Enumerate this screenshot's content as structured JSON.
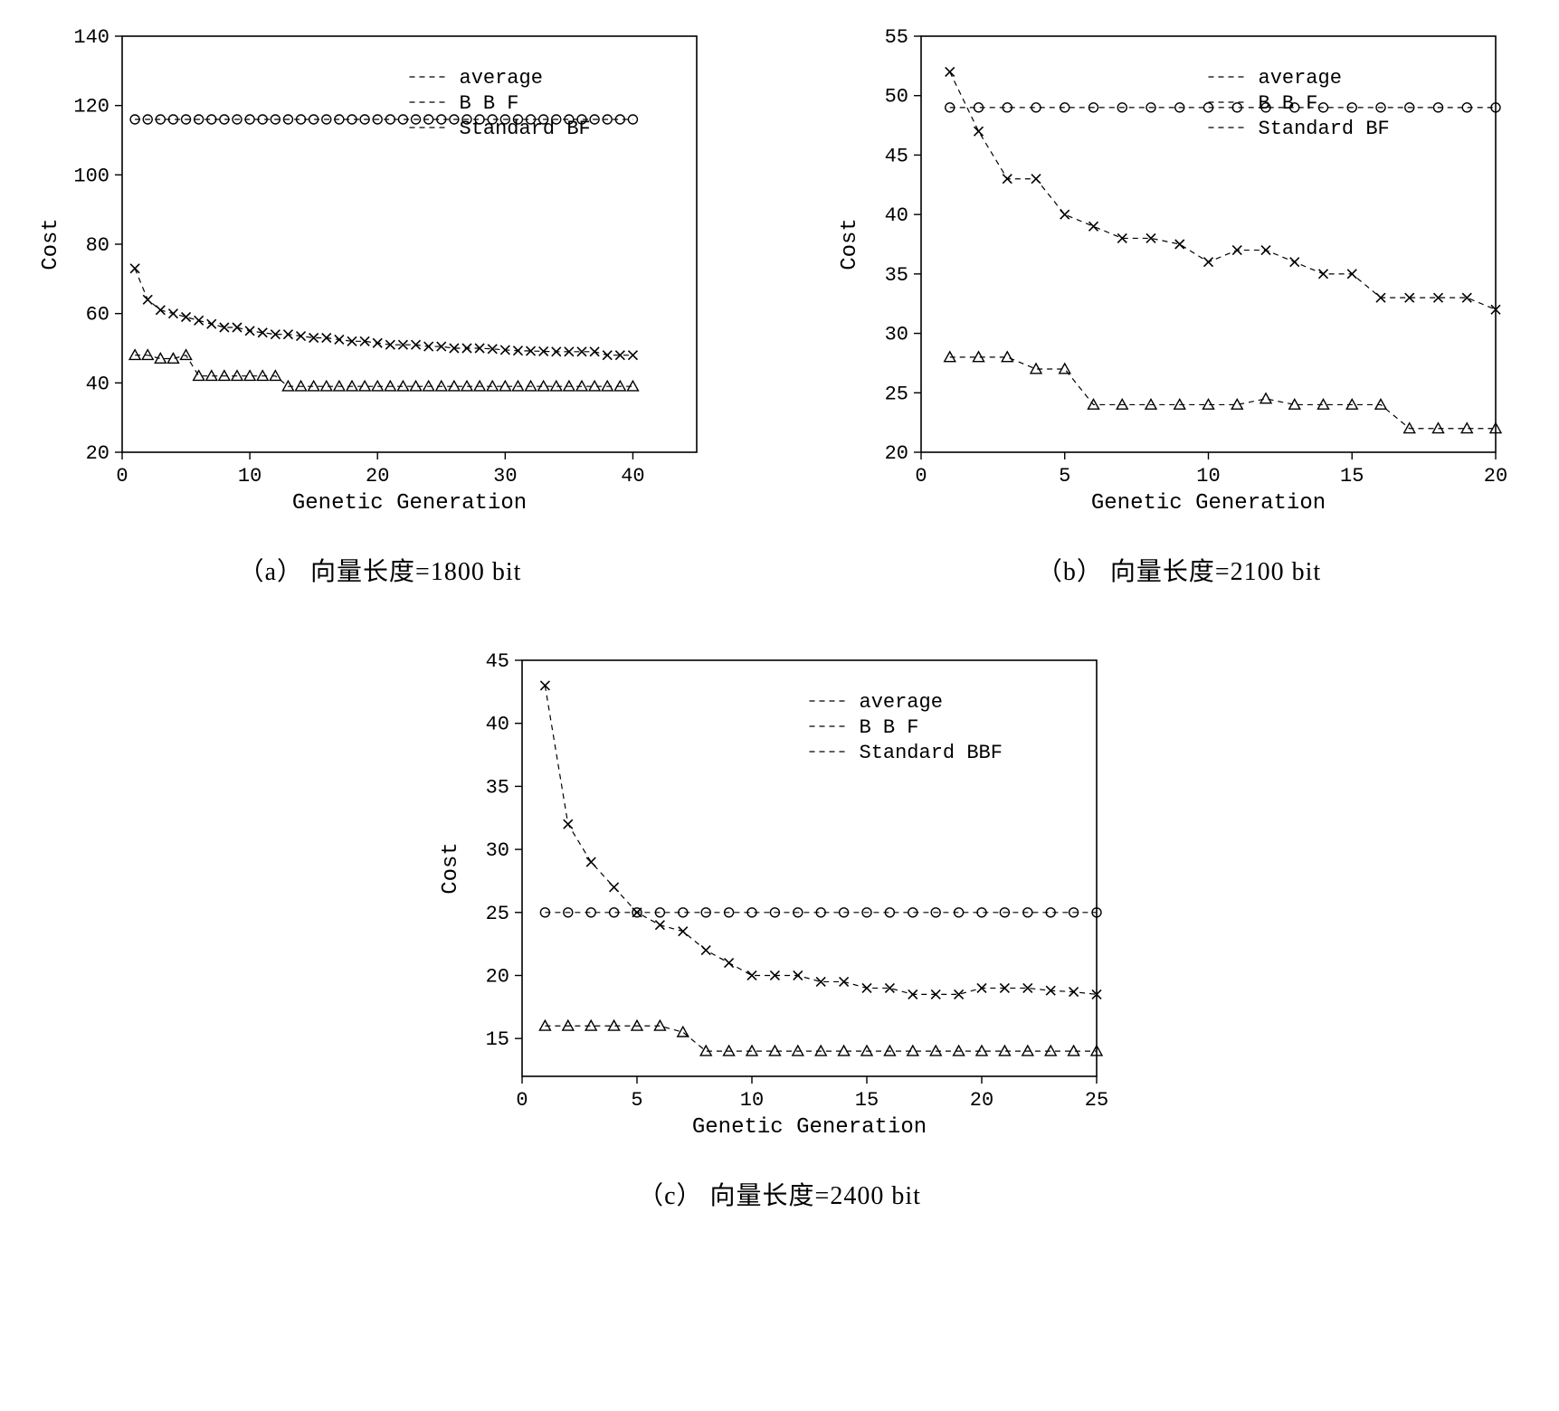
{
  "chart_data": [
    {
      "id": "a",
      "type": "line",
      "caption": "（a） 向量长度=1800 bit",
      "xlabel": "Genetic Generation",
      "ylabel": "Cost",
      "xlim": [
        0,
        45
      ],
      "ylim": [
        20,
        140
      ],
      "xticks": [
        0,
        10,
        20,
        30,
        40
      ],
      "yticks": [
        20,
        40,
        60,
        80,
        100,
        120,
        140
      ],
      "legend": [
        "average",
        "B B F",
        "Standard BF"
      ],
      "series": [
        {
          "name": "average",
          "marker": "x",
          "x": [
            1,
            2,
            3,
            4,
            5,
            6,
            7,
            8,
            9,
            10,
            11,
            12,
            13,
            14,
            15,
            16,
            17,
            18,
            19,
            20,
            21,
            22,
            23,
            24,
            25,
            26,
            27,
            28,
            29,
            30,
            31,
            32,
            33,
            34,
            35,
            36,
            37,
            38,
            39,
            40
          ],
          "y": [
            73,
            64,
            61,
            60,
            59,
            58,
            57,
            56,
            56,
            55,
            54.5,
            54,
            54,
            53.5,
            53,
            53,
            52.5,
            52,
            52,
            51.5,
            51,
            51,
            51,
            50.5,
            50.5,
            50,
            50,
            50,
            49.8,
            49.5,
            49.3,
            49.2,
            49.1,
            49,
            49,
            49,
            49,
            48,
            48,
            48
          ]
        },
        {
          "name": "B B F",
          "marker": "triangle",
          "x": [
            1,
            2,
            3,
            4,
            5,
            6,
            7,
            8,
            9,
            10,
            11,
            12,
            13,
            14,
            15,
            16,
            17,
            18,
            19,
            20,
            21,
            22,
            23,
            24,
            25,
            26,
            27,
            28,
            29,
            30,
            31,
            32,
            33,
            34,
            35,
            36,
            37,
            38,
            39,
            40
          ],
          "y": [
            48,
            48,
            47,
            47,
            48,
            42,
            42,
            42,
            42,
            42,
            42,
            42,
            39,
            39,
            39,
            39,
            39,
            39,
            39,
            39,
            39,
            39,
            39,
            39,
            39,
            39,
            39,
            39,
            39,
            39,
            39,
            39,
            39,
            39,
            39,
            39,
            39,
            39,
            39,
            39
          ]
        },
        {
          "name": "Standard BF",
          "marker": "circle",
          "x": [
            1,
            2,
            3,
            4,
            5,
            6,
            7,
            8,
            9,
            10,
            11,
            12,
            13,
            14,
            15,
            16,
            17,
            18,
            19,
            20,
            21,
            22,
            23,
            24,
            25,
            26,
            27,
            28,
            29,
            30,
            31,
            32,
            33,
            34,
            35,
            36,
            37,
            38,
            39,
            40
          ],
          "y": [
            116,
            116,
            116,
            116,
            116,
            116,
            116,
            116,
            116,
            116,
            116,
            116,
            116,
            116,
            116,
            116,
            116,
            116,
            116,
            116,
            116,
            116,
            116,
            116,
            116,
            116,
            116,
            116,
            116,
            116,
            116,
            116,
            116,
            116,
            116,
            116,
            116,
            116,
            116,
            116
          ]
        }
      ]
    },
    {
      "id": "b",
      "type": "line",
      "caption": "（b） 向量长度=2100 bit",
      "xlabel": "Genetic Generation",
      "ylabel": "Cost",
      "xlim": [
        0,
        20
      ],
      "ylim": [
        20,
        55
      ],
      "xticks": [
        0,
        5,
        10,
        15,
        20
      ],
      "yticks": [
        20,
        25,
        30,
        35,
        40,
        45,
        50,
        55
      ],
      "legend": [
        "average",
        "B B F",
        "Standard BF"
      ],
      "series": [
        {
          "name": "average",
          "marker": "x",
          "x": [
            1,
            2,
            3,
            4,
            5,
            6,
            7,
            8,
            9,
            10,
            11,
            12,
            13,
            14,
            15,
            16,
            17,
            18,
            19,
            20
          ],
          "y": [
            52,
            47,
            43,
            43,
            40,
            39,
            38,
            38,
            37.5,
            36,
            37,
            37,
            36,
            35,
            35,
            33,
            33,
            33,
            33,
            32
          ]
        },
        {
          "name": "B B F",
          "marker": "triangle",
          "x": [
            1,
            2,
            3,
            4,
            5,
            6,
            7,
            8,
            9,
            10,
            11,
            12,
            13,
            14,
            15,
            16,
            17,
            18,
            19,
            20
          ],
          "y": [
            28,
            28,
            28,
            27,
            27,
            24,
            24,
            24,
            24,
            24,
            24,
            24.5,
            24,
            24,
            24,
            24,
            22,
            22,
            22,
            22
          ]
        },
        {
          "name": "Standard BF",
          "marker": "circle",
          "x": [
            1,
            2,
            3,
            4,
            5,
            6,
            7,
            8,
            9,
            10,
            11,
            12,
            13,
            14,
            15,
            16,
            17,
            18,
            19,
            20
          ],
          "y": [
            49,
            49,
            49,
            49,
            49,
            49,
            49,
            49,
            49,
            49,
            49,
            49,
            49,
            49,
            49,
            49,
            49,
            49,
            49,
            49
          ]
        }
      ]
    },
    {
      "id": "c",
      "type": "line",
      "caption": "（c） 向量长度=2400 bit",
      "xlabel": "Genetic Generation",
      "ylabel": "Cost",
      "xlim": [
        0,
        25
      ],
      "ylim": [
        12,
        45
      ],
      "xticks": [
        0,
        5,
        10,
        15,
        20,
        25
      ],
      "yticks": [
        15,
        20,
        25,
        30,
        35,
        40,
        45
      ],
      "legend": [
        "average",
        "B B F",
        "Standard BBF"
      ],
      "series": [
        {
          "name": "average",
          "marker": "x",
          "x": [
            1,
            2,
            3,
            4,
            5,
            6,
            7,
            8,
            9,
            10,
            11,
            12,
            13,
            14,
            15,
            16,
            17,
            18,
            19,
            20,
            21,
            22,
            23,
            24,
            25
          ],
          "y": [
            43,
            32,
            29,
            27,
            25,
            24,
            23.5,
            22,
            21,
            20,
            20,
            20,
            19.5,
            19.5,
            19,
            19,
            18.5,
            18.5,
            18.5,
            19,
            19,
            19,
            18.8,
            18.7,
            18.5
          ]
        },
        {
          "name": "B B F",
          "marker": "triangle",
          "x": [
            1,
            2,
            3,
            4,
            5,
            6,
            7,
            8,
            9,
            10,
            11,
            12,
            13,
            14,
            15,
            16,
            17,
            18,
            19,
            20,
            21,
            22,
            23,
            24,
            25
          ],
          "y": [
            16,
            16,
            16,
            16,
            16,
            16,
            15.5,
            14,
            14,
            14,
            14,
            14,
            14,
            14,
            14,
            14,
            14,
            14,
            14,
            14,
            14,
            14,
            14,
            14,
            14
          ]
        },
        {
          "name": "Standard BBF",
          "marker": "circle",
          "x": [
            1,
            2,
            3,
            4,
            5,
            6,
            7,
            8,
            9,
            10,
            11,
            12,
            13,
            14,
            15,
            16,
            17,
            18,
            19,
            20,
            21,
            22,
            23,
            24,
            25
          ],
          "y": [
            25,
            25,
            25,
            25,
            25,
            25,
            25,
            25,
            25,
            25,
            25,
            25,
            25,
            25,
            25,
            25,
            25,
            25,
            25,
            25,
            25,
            25,
            25,
            25,
            25
          ]
        }
      ]
    }
  ]
}
